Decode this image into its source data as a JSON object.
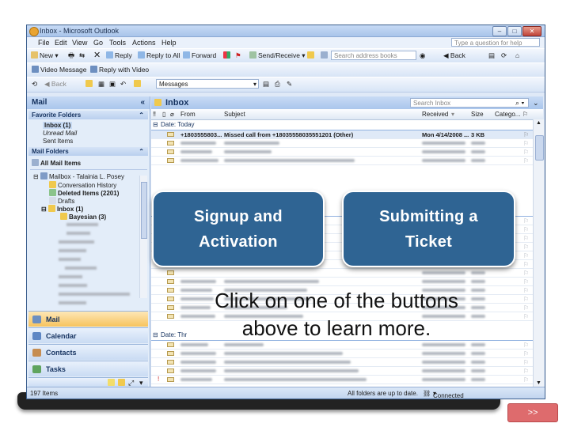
{
  "window": {
    "title": "Inbox - Microsoft Outlook",
    "controls": [
      "–",
      "□",
      "✕"
    ]
  },
  "menu": {
    "items": [
      "File",
      "Edit",
      "View",
      "Go",
      "Tools",
      "Actions",
      "Help"
    ],
    "help_placeholder": "Type a question for help"
  },
  "toolbar1": {
    "new": "New",
    "reply": "Reply",
    "reply_all": "Reply to All",
    "forward": "Forward",
    "send_receive": "Send/Receive",
    "search_placeholder": "Search address books",
    "back": "Back"
  },
  "toolbar2": {
    "video_message": "Video Message",
    "reply_video": "Reply with Video"
  },
  "toolbar3": {
    "back": "Back",
    "messages": "Messages"
  },
  "nav": {
    "title": "Mail",
    "favorites_header": "Favorite Folders",
    "favorites": [
      "Inbox (1)",
      "Unread Mail",
      "Sent Items"
    ],
    "mail_folders_header": "Mail Folders",
    "all_mail_items": "All Mail Items",
    "mailbox": "Mailbox - Talainia L. Posey",
    "folders": [
      "Conversation History",
      "Deleted Items (2201)",
      "Drafts",
      "Inbox (1)",
      "Bayesian (3)"
    ],
    "buttons": [
      "Mail",
      "Calendar",
      "Contacts",
      "Tasks"
    ]
  },
  "list": {
    "title": "Inbox",
    "search_placeholder": "Search Inbox",
    "columns": {
      "from": "From",
      "subject": "Subject",
      "received": "Received",
      "size": "Size",
      "category": "Catego..."
    },
    "group_today": "Date: Today",
    "group_3": "Date: Thr",
    "selected_row": {
      "from": "+1803555803...",
      "subject": "Missed call from +18035558035551201 (Other)",
      "received": "Mon 4/14/2008 ...",
      "size": "3 KB"
    }
  },
  "status": {
    "items": "197 Items",
    "sync": "All folders are up to date.",
    "connection": "Connected to Microsoft Exchange"
  },
  "overlay": {
    "btn_signup": "Signup and\nActivation",
    "btn_ticket": "Submitting a\nTicket",
    "instruction": "Click on one of the buttons\nabove to learn more.",
    "next": ">>"
  },
  "colors": {
    "cta_bg": "#2f6493",
    "next_bg": "#de6b6d",
    "frame": "#3c5f8e"
  }
}
